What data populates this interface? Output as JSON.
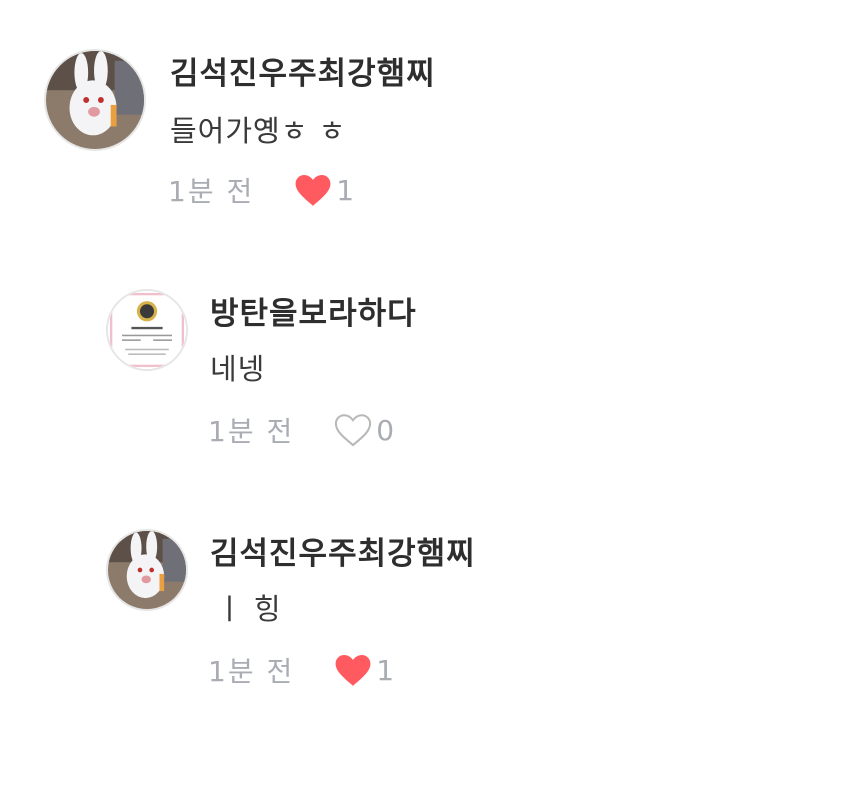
{
  "comments": [
    {
      "author": "김석진우주최강햄찌",
      "text": "들어가옝ㅎ ㅎ",
      "time": "1분 전",
      "liked": true,
      "likes": "1",
      "avatar_icon": "bunny-avatar-icon"
    },
    {
      "author": "방탄을보라하다",
      "text": "네넹",
      "time": "1분 전",
      "liked": false,
      "likes": "0",
      "avatar_icon": "certificate-avatar-icon"
    },
    {
      "author": "김석진우주최강햄찌",
      "text": "ㅣ 힝",
      "time": "1분 전",
      "liked": true,
      "likes": "1",
      "avatar_icon": "bunny-avatar-icon"
    }
  ],
  "colors": {
    "heart_liked": "#ff5a5f",
    "heart_outline": "#b8b8b8",
    "meta_text": "#a9adb3"
  }
}
